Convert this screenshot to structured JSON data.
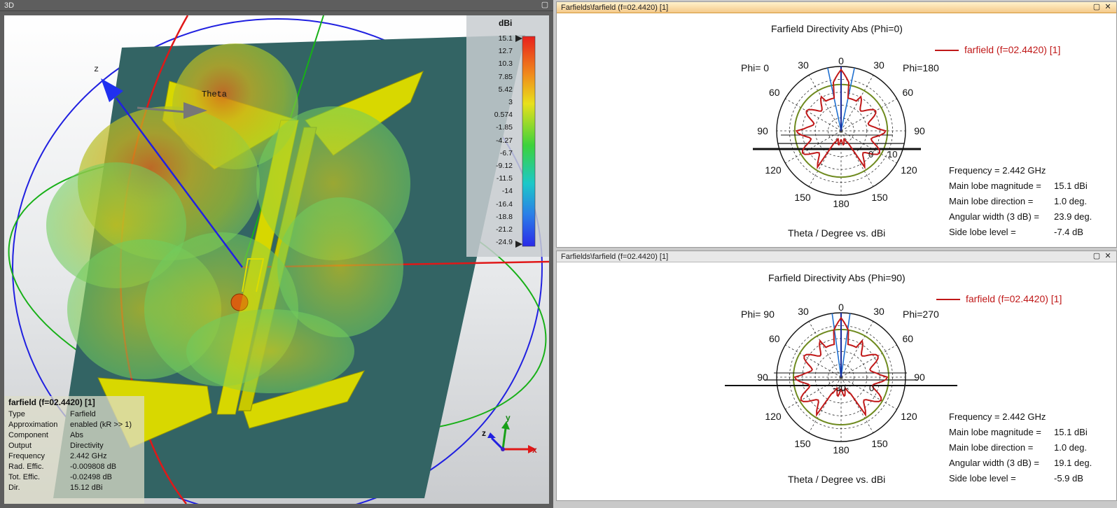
{
  "view3d": {
    "title": "3D",
    "colorbar": {
      "unit": "dBi",
      "ticks": [
        "15.1",
        "12.7",
        "10.3",
        "7.85",
        "5.42",
        "3",
        "0.574",
        "-1.85",
        "-4.27",
        "-6.7",
        "-9.12",
        "-11.5",
        "-14",
        "-16.4",
        "-18.8",
        "-21.2",
        "-24.9"
      ]
    },
    "axis_labels": {
      "z": "z",
      "theta": "Theta"
    },
    "triad": {
      "x": "x",
      "y": "y",
      "z": "z"
    },
    "info": {
      "title": "farfield (f=02.4420) [1]",
      "rows": [
        {
          "key": "Type",
          "value": "Farfield"
        },
        {
          "key": "Approximation",
          "value": "enabled (kR >> 1)"
        },
        {
          "key": "Component",
          "value": "Abs"
        },
        {
          "key": "Output",
          "value": "Directivity"
        },
        {
          "key": "Frequency",
          "value": "2.442 GHz"
        },
        {
          "key": "Rad. Effic.",
          "value": "-0.009808 dB"
        },
        {
          "key": "Tot. Effic.",
          "value": "-0.02498 dB"
        },
        {
          "key": "Dir.",
          "value": "15.12 dBi"
        }
      ]
    }
  },
  "panel_top": {
    "window_title": "Farfields\\farfield (f=02.4420) [1]",
    "title": "Farfield Directivity Abs (Phi=0)",
    "legend": "farfield (f=02.4420) [1]",
    "phi_left": "Phi=  0",
    "phi_right": "Phi=180",
    "angle_labels": {
      "t0": "0",
      "l30": "30",
      "r30": "30",
      "l60": "60",
      "r60": "60",
      "l90": "90",
      "r90": "90",
      "l120": "120",
      "r120": "120",
      "l150": "150",
      "r150": "150",
      "t180": "180"
    },
    "radial_labels": [
      "0",
      "10"
    ],
    "xlabel": "Theta / Degree vs. dBi",
    "info": [
      {
        "label": "Frequency = 2.442 GHz",
        "value": ""
      },
      {
        "label": "Main lobe magnitude =",
        "value": "15.1 dBi"
      },
      {
        "label": "Main lobe direction =",
        "value": "1.0 deg."
      },
      {
        "label": "Angular width (3 dB) =",
        "value": "23.9 deg."
      },
      {
        "label": "Side lobe level =",
        "value": "-7.4 dB"
      }
    ]
  },
  "panel_bottom": {
    "window_title": "Farfields\\farfield (f=02.4420) [1]",
    "title": "Farfield Directivity Abs (Phi=90)",
    "legend": "farfield (f=02.4420) [1]",
    "phi_left": "Phi= 90",
    "phi_right": "Phi=270",
    "angle_labels": {
      "t0": "0",
      "l30": "30",
      "r30": "30",
      "l60": "60",
      "r60": "60",
      "l90": "90",
      "r90": "90",
      "l120": "120",
      "r120": "120",
      "l150": "150",
      "r150": "150",
      "t180": "180"
    },
    "radial_labels": [
      "-30",
      "0"
    ],
    "xlabel": "Theta / Degree vs. dBi",
    "info": [
      {
        "label": "Frequency = 2.442 GHz",
        "value": ""
      },
      {
        "label": "Main lobe magnitude =",
        "value": "15.1 dBi"
      },
      {
        "label": "Main lobe direction =",
        "value": "1.0 deg."
      },
      {
        "label": "Angular width (3 dB) =",
        "value": "19.1 deg."
      },
      {
        "label": "Side lobe level =",
        "value": "-5.9 dB"
      }
    ]
  },
  "colors": {
    "pattern": "#c01818",
    "ring_3db": "#6e8a1e",
    "beam_lines": "#1e6fd0",
    "board": "#336464",
    "copper": "#d8d800"
  }
}
